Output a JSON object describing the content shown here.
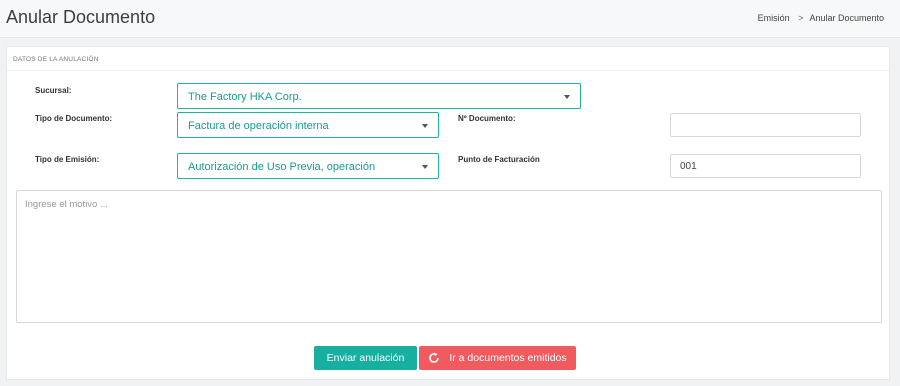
{
  "header": {
    "title": "Anular Documento",
    "breadcrumb": [
      "Emisión",
      "Anular Documento"
    ],
    "breadcrumb_sep": ">"
  },
  "card": {
    "title": "DATOS DE LA ANULACIÓN"
  },
  "form": {
    "sucursal": {
      "label": "Sucursal:",
      "value": "The Factory HKA Corp."
    },
    "tipo_documento": {
      "label": "Tipo de Documento:",
      "value": "Factura de operación interna"
    },
    "tipo_emision": {
      "label": "Tipo de Emisión:",
      "value": "Autorización de Uso Previa, operación"
    },
    "n_documento": {
      "label": "Nº Documento:",
      "value": ""
    },
    "punto_facturacion": {
      "label": "Punto de Facturación",
      "value": "001"
    },
    "motivo": {
      "placeholder": "Ingrese el motivo ..."
    }
  },
  "actions": {
    "send_label": "Enviar anulación",
    "go_label": "Ir a documentos emitidos"
  },
  "colors": {
    "accent": "#17b0a0",
    "danger": "#ef5b5e"
  }
}
